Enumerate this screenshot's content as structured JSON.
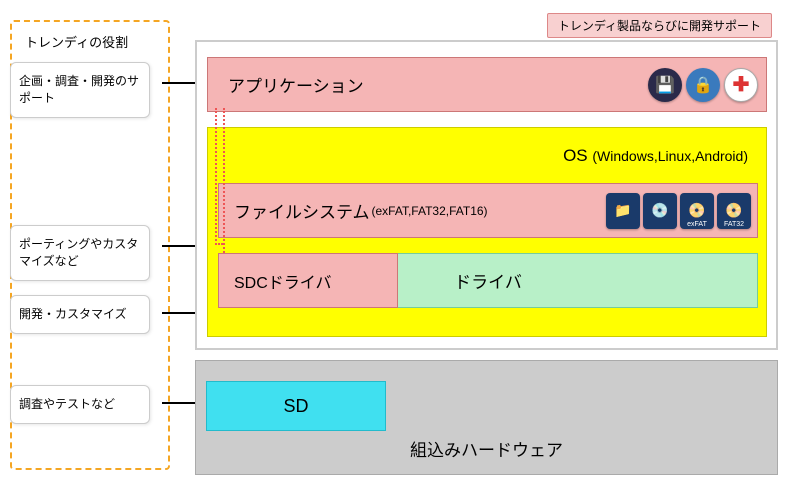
{
  "left": {
    "title": "トレンディの役割",
    "roles": [
      "企画・調査・開発のサポート",
      "ポーティングやカスタマイズなど",
      "開発・カスタマイズ",
      "調査やテストなど"
    ]
  },
  "top_label": "トレンディ製品ならびに開発サポート",
  "layers": {
    "application": "アプリケーション",
    "os": {
      "name": "OS",
      "sub": "(Windows,Linux,Android)"
    },
    "filesystem": {
      "name": "ファイルシステム",
      "sub": "(exFAT,FAT32,FAT16)"
    },
    "driver": "ドライバ",
    "sdc": "SDCドライバ",
    "sd": "SD",
    "hardware": "組込みハードウェア"
  },
  "fs_icon_labels": [
    "exFAT",
    "FAT32"
  ],
  "colors": {
    "pink": "#f5b5b5",
    "yellow": "#ffff00",
    "green": "#b8f0c8",
    "cyan": "#40e0f0",
    "gray": "#cccccc",
    "dashed": "#f5a623"
  }
}
